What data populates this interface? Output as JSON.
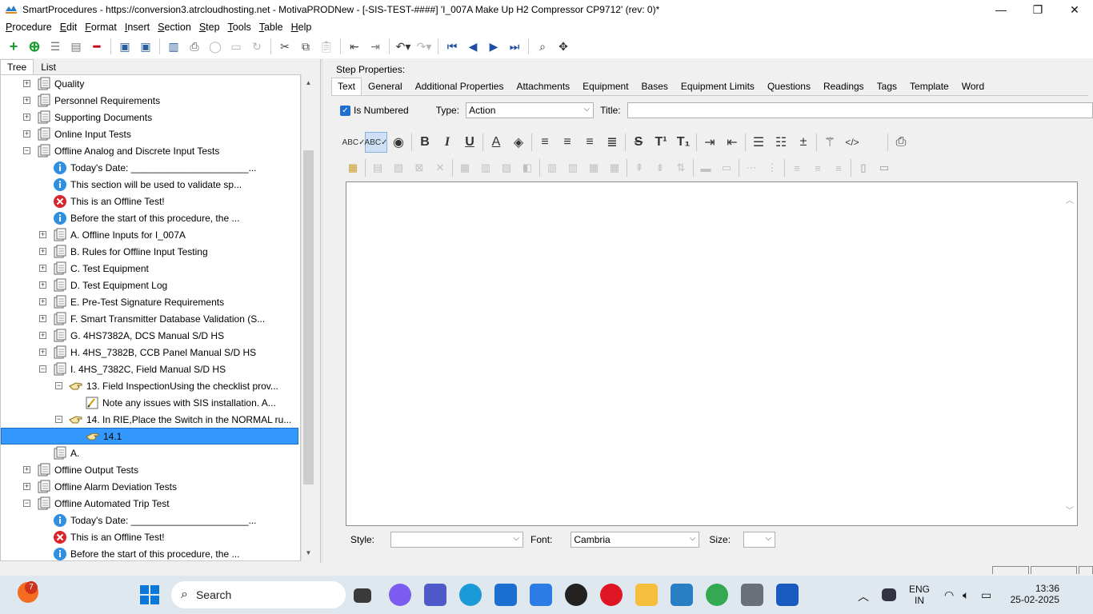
{
  "window": {
    "title": "SmartProcedures - https://conversion3.atrcloudhosting.net - MotivaPRODNew - [-SIS-TEST-####] 'I_007A Make Up H2 Compressor CP9712' (rev: 0)*",
    "minimize": "—",
    "maximize": "❐",
    "close": "✕"
  },
  "menu": [
    "Procedure",
    "Edit",
    "Format",
    "Insert",
    "Section",
    "Step",
    "Tools",
    "Table",
    "Help"
  ],
  "left_tabs": [
    "Tree",
    "List"
  ],
  "tree": [
    {
      "label": "Quality",
      "level": 0,
      "expander": "+",
      "icon": "document-icon"
    },
    {
      "label": "Personnel Requirements",
      "level": 0,
      "expander": "+",
      "icon": "document-icon"
    },
    {
      "label": "Supporting Documents",
      "level": 0,
      "expander": "+",
      "icon": "document-icon"
    },
    {
      "label": "Online Input Tests",
      "level": 0,
      "expander": "+",
      "icon": "document-icon"
    },
    {
      "label": "Offline Analog and Discrete Input Tests",
      "level": 0,
      "expander": "−",
      "icon": "document-icon"
    },
    {
      "label": "Today's Date: ______________________...",
      "level": 1,
      "expander": "",
      "icon": "info-icon"
    },
    {
      "label": "This section will be used to validate sp...",
      "level": 1,
      "expander": "",
      "icon": "info-icon"
    },
    {
      "label": "This is an Offline Test!",
      "level": 1,
      "expander": "",
      "icon": "error-icon"
    },
    {
      "label": "Before the start of this procedure, the ...",
      "level": 1,
      "expander": "",
      "icon": "info-icon"
    },
    {
      "label": "A. Offline Inputs for I_007A",
      "level": 1,
      "expander": "+",
      "icon": "document-icon"
    },
    {
      "label": "B. Rules for Offline Input Testing",
      "level": 1,
      "expander": "+",
      "icon": "document-icon"
    },
    {
      "label": "C. Test Equipment",
      "level": 1,
      "expander": "+",
      "icon": "document-icon"
    },
    {
      "label": "D. Test Equipment Log",
      "level": 1,
      "expander": "+",
      "icon": "document-icon"
    },
    {
      "label": "E. Pre-Test Signature Requirements",
      "level": 1,
      "expander": "+",
      "icon": "document-icon"
    },
    {
      "label": "F. Smart Transmitter Database Validation (S...",
      "level": 1,
      "expander": "+",
      "icon": "document-icon"
    },
    {
      "label": "G. 4HS7382A, DCS Manual S/D HS",
      "level": 1,
      "expander": "+",
      "icon": "document-icon"
    },
    {
      "label": "H. 4HS_7382B, CCB Panel Manual S/D HS",
      "level": 1,
      "expander": "+",
      "icon": "document-icon"
    },
    {
      "label": "I. 4HS_7382C, Field Manual S/D HS",
      "level": 1,
      "expander": "−",
      "icon": "document-icon"
    },
    {
      "label": "13. Field InspectionUsing the checklist prov...",
      "level": 2,
      "expander": "−",
      "icon": "hand-pointer-icon"
    },
    {
      "label": "Note any issues with SIS installation. A...",
      "level": 3,
      "expander": "",
      "icon": "note-icon"
    },
    {
      "label": "14. In RIE,Place the Switch in the NORMAL ru...",
      "level": 2,
      "expander": "−",
      "icon": "hand-pointer-icon"
    },
    {
      "label": "14.1",
      "level": 3,
      "expander": "",
      "icon": "hand-pointer-icon",
      "selected": true
    },
    {
      "label": "A.",
      "level": 1,
      "expander": "",
      "icon": "document-icon"
    },
    {
      "label": "Offline Output Tests",
      "level": 0,
      "expander": "+",
      "icon": "document-icon"
    },
    {
      "label": "Offline Alarm Deviation Tests",
      "level": 0,
      "expander": "+",
      "icon": "document-icon"
    },
    {
      "label": "Offline Automated Trip Test",
      "level": 0,
      "expander": "−",
      "icon": "document-icon"
    },
    {
      "label": "Today's Date: ______________________...",
      "level": 1,
      "expander": "",
      "icon": "info-icon"
    },
    {
      "label": "This is an Offline Test!",
      "level": 1,
      "expander": "",
      "icon": "error-icon"
    },
    {
      "label": "Before the start of this procedure, the ...",
      "level": 1,
      "expander": "",
      "icon": "info-icon"
    }
  ],
  "step_properties": {
    "heading": "Step Properties:",
    "tabs": [
      "Text",
      "General",
      "Additional Properties",
      "Attachments",
      "Equipment",
      "Bases",
      "Equipment Limits",
      "Questions",
      "Readings",
      "Tags",
      "Template",
      "Word"
    ],
    "is_numbered_label": "Is Numbered",
    "is_numbered": true,
    "type_label": "Type:",
    "type_value": "Action",
    "title_label": "Title:",
    "title_value": ""
  },
  "bottom": {
    "style_label": "Style:",
    "style_value": "",
    "font_label": "Font:",
    "font_value": "Cambria",
    "size_label": "Size:",
    "size_value": ""
  },
  "taskbar": {
    "search_placeholder": "Search",
    "notification_count": "7",
    "language": "ENG",
    "region": "IN",
    "time": "13:36",
    "date": "25-02-2025"
  },
  "colors": {
    "selection": "#3399ff",
    "accent": "#1e6fd0",
    "taskbar": "#dfe7ef"
  }
}
